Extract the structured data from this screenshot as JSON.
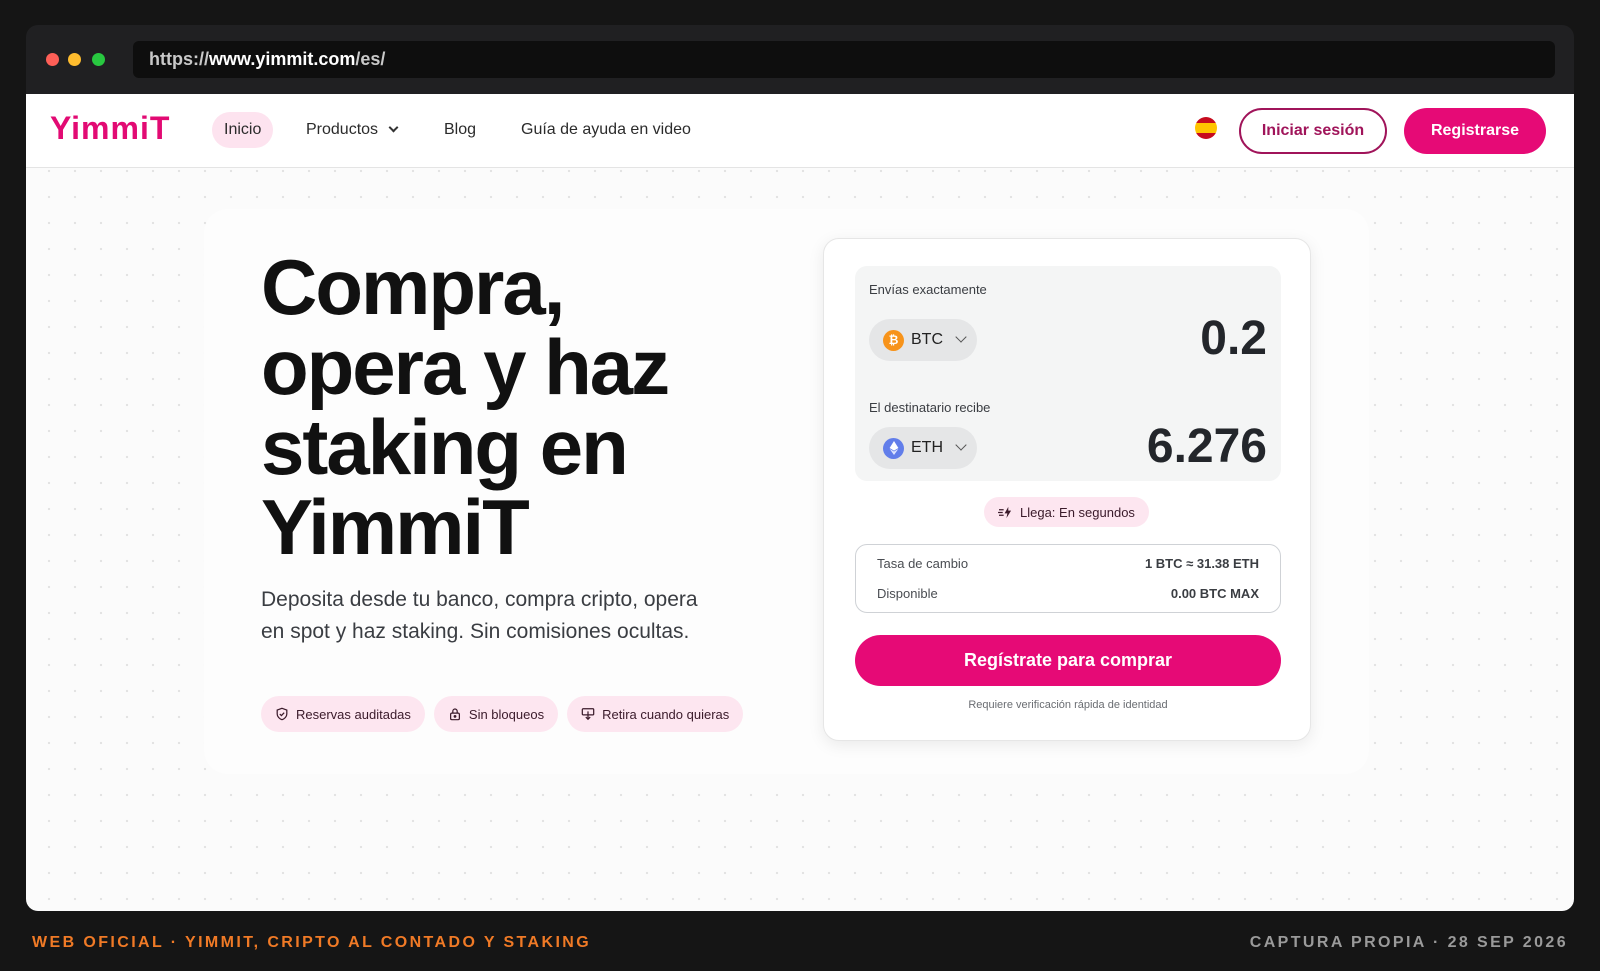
{
  "browser": {
    "url_scheme": "https://",
    "url_host": "www.yimmit.com",
    "url_path": "/es/"
  },
  "nav": {
    "logo": "YimmiT",
    "links": [
      {
        "label": "Inicio",
        "active": true
      },
      {
        "label": "Productos",
        "has_dropdown": true
      },
      {
        "label": "Blog"
      },
      {
        "label": "Guía de ayuda en video"
      }
    ],
    "language_flag": "spain-flag-icon",
    "login_label": "Iniciar sesión",
    "register_label": "Registrarse"
  },
  "hero": {
    "headline_lines": [
      "Compra,",
      "opera y haz",
      "staking en",
      "YimmiT"
    ],
    "subtitle": "Deposita desde tu banco, compra cripto, opera en spot y haz staking. Sin comisiones ocultas.",
    "badges": [
      {
        "icon": "shield-check-icon",
        "label": "Reservas auditadas"
      },
      {
        "icon": "unlock-icon",
        "label": "Sin bloqueos"
      },
      {
        "icon": "withdraw-icon",
        "label": "Retira cuando quieras"
      }
    ]
  },
  "widget": {
    "send_label": "Envías exactamente",
    "send_coin": "BTC",
    "send_amount": "0.2",
    "receive_label": "El destinatario recibe",
    "receive_coin": "ETH",
    "receive_amount": "6.276",
    "eta": "Llega: En segundos",
    "rate_label": "Tasa de cambio",
    "rate_value": "1 BTC ≈ 31.38 ETH",
    "available_label": "Disponible",
    "available_value": "0.00 BTC MAX",
    "cta": "Regístrate para comprar",
    "note": "Requiere verificación rápida de identidad"
  },
  "caption": {
    "left": "WEB OFICIAL · YIMMIT, CRIPTO AL CONTADO Y STAKING",
    "right": "CAPTURA PROPIA · 28 SEP 2026"
  },
  "colors": {
    "brand": "#e20a73",
    "brand_dark": "#a0145a",
    "badge_bg": "#fde6f0",
    "caption_accent": "#f07a26",
    "btc": "#f7931a",
    "eth": "#627eea"
  }
}
